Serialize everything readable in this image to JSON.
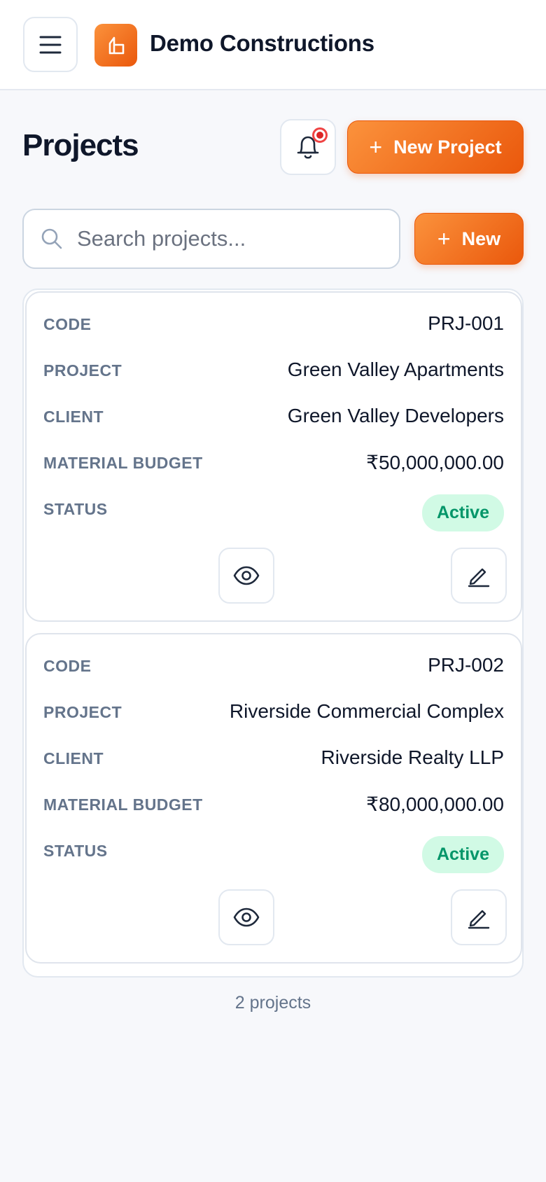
{
  "header": {
    "brand": "Demo Constructions"
  },
  "page": {
    "title": "Projects",
    "new_project_label": "New Project",
    "new_label": "New"
  },
  "search": {
    "placeholder": "Search projects...",
    "value": ""
  },
  "table": {
    "labels": {
      "code": "CODE",
      "project": "PROJECT",
      "client": "CLIENT",
      "budget": "MATERIAL BUDGET",
      "status": "STATUS"
    },
    "rows": [
      {
        "code": "PRJ-001",
        "project": "Green Valley Apartments",
        "client": "Green Valley Developers",
        "budget": "₹50,000,000.00",
        "status": "Active"
      },
      {
        "code": "PRJ-002",
        "project": "Riverside Commercial Complex",
        "client": "Riverside Realty LLP",
        "budget": "₹80,000,000.00",
        "status": "Active"
      }
    ]
  },
  "footer": {
    "count": "2 projects"
  },
  "colors": {
    "accent": "#ea580c",
    "status_active_bg": "#d1fae5",
    "status_active_text": "#059669",
    "notification": "#dc2626"
  },
  "icons": {
    "menu": "menu-icon",
    "logo": "building-logo-icon",
    "bell": "bell-icon",
    "plus": "plus-icon",
    "search": "search-icon",
    "view": "eye-icon",
    "edit": "pencil-icon"
  }
}
